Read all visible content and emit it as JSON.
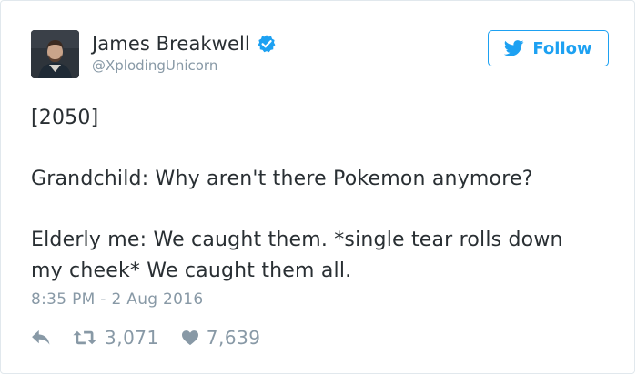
{
  "user": {
    "display_name": "James Breakwell",
    "handle": "@XplodingUnicorn",
    "verified": true,
    "avatar_icon": "user-photo"
  },
  "follow_button": {
    "label": "Follow",
    "icon": "twitter-bird-icon"
  },
  "tweet": {
    "lines": [
      "[2050]",
      "Grandchild: Why aren't there Pokemon anymore?",
      "Elderly me: We caught them. *single tear rolls down",
      "my cheek* We caught them all."
    ],
    "timestamp": "8:35 PM - 2 Aug 2016"
  },
  "actions": {
    "reply_icon": "reply-icon",
    "retweet_icon": "retweet-icon",
    "retweet_count": "3,071",
    "like_icon": "heart-icon",
    "like_count": "7,639"
  },
  "colors": {
    "accent": "#1da1f2",
    "text": "#292f33",
    "muted": "#8899a6",
    "border": "#e1e8ed"
  }
}
